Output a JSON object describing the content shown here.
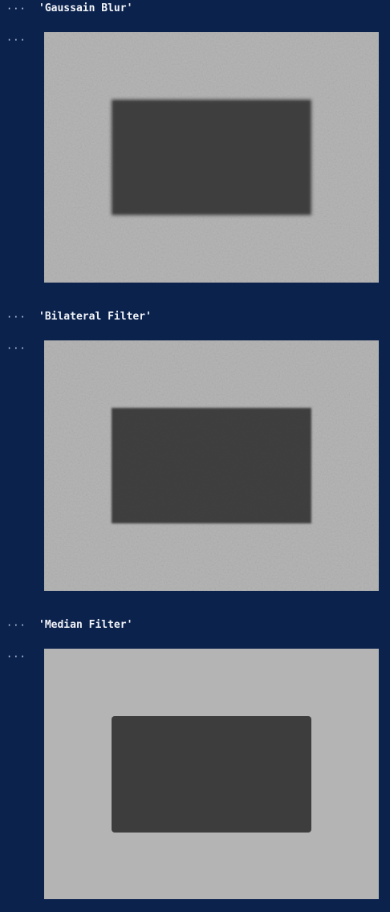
{
  "notebook": {
    "prompt_glyph": "···",
    "outputs": [
      {
        "type": "text",
        "value": "'Gaussain Blur'"
      },
      {
        "type": "image",
        "alt": "gaussian-blur-result"
      },
      {
        "type": "text",
        "value": "'Bilateral Filter'"
      },
      {
        "type": "image",
        "alt": "bilateral-filter-result"
      },
      {
        "type": "text",
        "value": "'Median Filter'"
      },
      {
        "type": "image",
        "alt": "median-filter-result"
      }
    ]
  },
  "colors": {
    "background": "#0b224d",
    "image_light": "#b4b4b4",
    "image_dark": "#3d3d3d"
  }
}
